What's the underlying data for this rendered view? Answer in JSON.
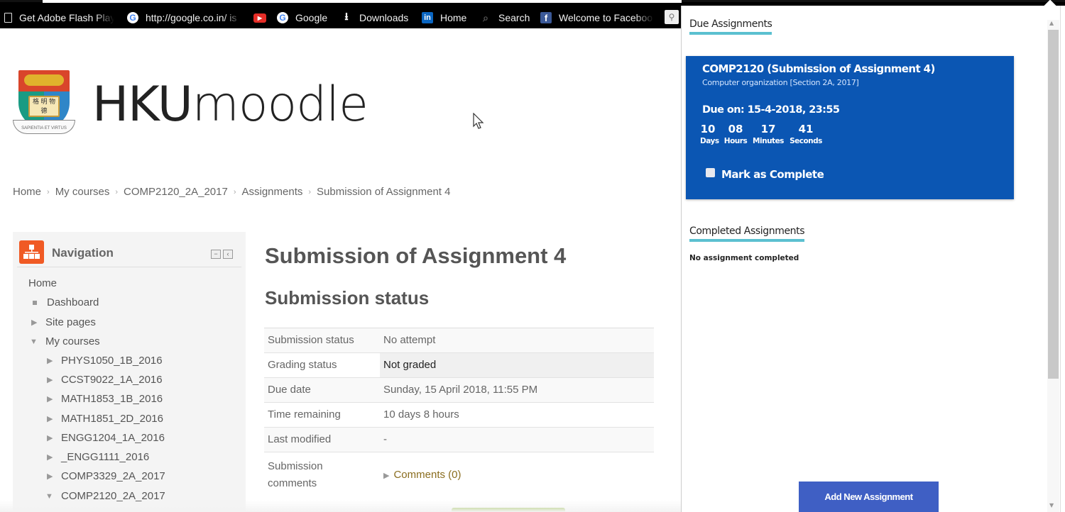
{
  "bookmarks": [
    {
      "icon": "page-icon",
      "label": "Get Adobe Flash Play"
    },
    {
      "icon": "google-icon",
      "label": "http://google.co.in/ is"
    },
    {
      "icon": "youtube-icon",
      "label": ""
    },
    {
      "icon": "google-icon",
      "label": "Google"
    },
    {
      "icon": "download-icon",
      "label": "Downloads"
    },
    {
      "icon": "linkedin-icon",
      "label": "Home"
    },
    {
      "icon": "search-icon",
      "label": "Search"
    },
    {
      "icon": "facebook-icon",
      "label": "Welcome to Faceboo"
    }
  ],
  "logo": {
    "bold": "HKU",
    "light": "moodle",
    "crest_book": "格 明 物 德",
    "crest_motto": "SAPIENTIA ET VIRTUS"
  },
  "breadcrumb": [
    "Home",
    "My courses",
    "COMP2120_2A_2017",
    "Assignments",
    "Submission of Assignment 4"
  ],
  "navigation": {
    "title": "Navigation",
    "home": "Home",
    "dashboard": "Dashboard",
    "site_pages": "Site pages",
    "my_courses": "My courses",
    "courses": [
      "PHYS1050_1B_2016",
      "CCST9022_1A_2016",
      "MATH1853_1B_2016",
      "MATH1851_2D_2016",
      "ENGG1204_1A_2016",
      "_ENGG1111_2016",
      "COMP3329_2A_2017",
      "COMP2120_2A_2017"
    ]
  },
  "main": {
    "title": "Submission of Assignment 4",
    "subtitle": "Submission status",
    "rows": [
      {
        "key": "Submission status",
        "value": "No attempt"
      },
      {
        "key": "Grading status",
        "value": "Not graded"
      },
      {
        "key": "Due date",
        "value": "Sunday, 15 April 2018, 11:55 PM"
      },
      {
        "key": "Time remaining",
        "value": "10 days 8 hours"
      },
      {
        "key": "Last modified",
        "value": "-"
      },
      {
        "key": "Submission comments",
        "value": "Comments (0)"
      }
    ]
  },
  "popup": {
    "due_title": "Due Assignments",
    "card": {
      "title": "COMP2120 (Submission of Assignment 4)",
      "subtitle": "Computer organization [Section 2A, 2017]",
      "due": "Due on: 15-4-2018, 23:55",
      "countdown": [
        {
          "value": "10",
          "label": "Days"
        },
        {
          "value": "08",
          "label": "Hours"
        },
        {
          "value": "17",
          "label": "Minutes"
        },
        {
          "value": "41",
          "label": "Seconds"
        }
      ],
      "mark_label": "Mark as Complete",
      "color": "#0b56b3"
    },
    "completed_title": "Completed Assignments",
    "completed_empty": "No assignment completed",
    "add_button": "Add New Assignment",
    "accent": "#5bc0d0"
  }
}
